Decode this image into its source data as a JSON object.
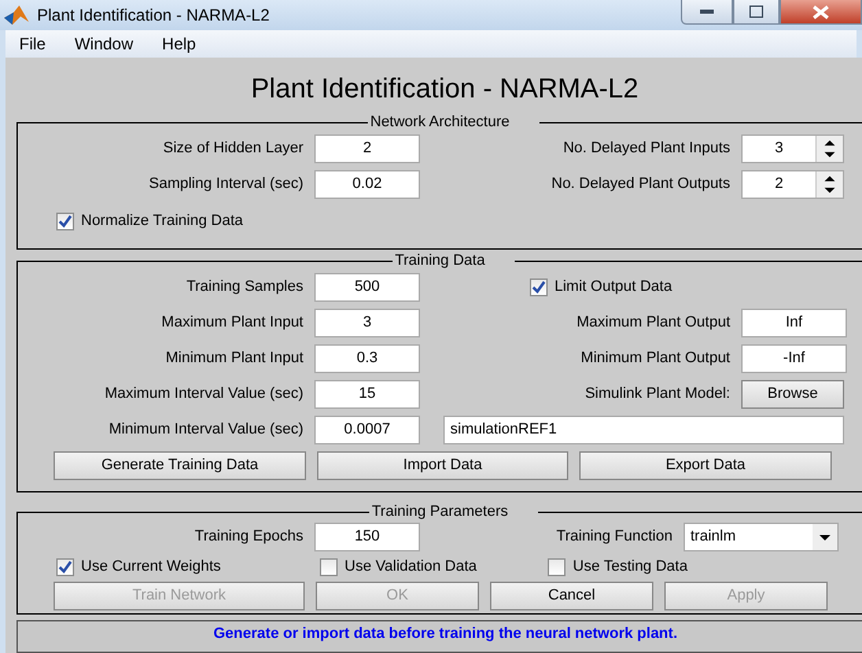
{
  "window": {
    "title": "Plant Identification - NARMA-L2"
  },
  "menu": [
    "File",
    "Window",
    "Help"
  ],
  "heading": "Plant Identification - NARMA-L2",
  "network_architecture": {
    "title": "Network Architecture",
    "rows": [
      {
        "left": {
          "label": "Size of Hidden Layer",
          "value": "2"
        },
        "right": {
          "kind": "spinner",
          "label": "No. Delayed Plant Inputs",
          "value": "3"
        }
      },
      {
        "left": {
          "label": "Sampling Interval (sec)",
          "value": "0.02"
        },
        "right": {
          "kind": "spinner",
          "label": "No. Delayed Plant Outputs",
          "value": "2"
        }
      }
    ],
    "normalize": {
      "label": "Normalize Training Data",
      "checked": true
    }
  },
  "training_data": {
    "title": "Training Data",
    "rows": [
      {
        "left": {
          "label": "Training Samples",
          "value": "500"
        },
        "right": {
          "kind": "checkbox",
          "label": "Limit Output Data",
          "checked": true
        }
      },
      {
        "left": {
          "label": "Maximum Plant Input",
          "value": "3"
        },
        "right": {
          "kind": "field",
          "label": "Maximum Plant Output",
          "value": "Inf"
        }
      },
      {
        "left": {
          "label": "Minimum Plant Input",
          "value": "0.3"
        },
        "right": {
          "kind": "field",
          "label": "Minimum Plant Output",
          "value": "-Inf"
        }
      },
      {
        "left": {
          "label": "Maximum Interval Value (sec)",
          "value": "15"
        },
        "right": {
          "kind": "button",
          "label": "Simulink Plant Model:",
          "button": "Browse"
        }
      },
      {
        "left": {
          "label": "Minimum Interval Value (sec)",
          "value": "0.0007"
        },
        "right": {
          "kind": "wide_field",
          "value": "simulationREF1"
        }
      }
    ],
    "buttons": [
      "Generate Training Data",
      "Import Data",
      "Export Data"
    ]
  },
  "training_parameters": {
    "title": "Training Parameters",
    "epochs": {
      "label": "Training Epochs",
      "value": "150"
    },
    "function": {
      "label": "Training Function",
      "value": "trainlm"
    },
    "checkboxes": [
      {
        "label": "Use Current Weights",
        "checked": true
      },
      {
        "label": "Use Validation Data",
        "checked": false
      },
      {
        "label": "Use Testing Data",
        "checked": false
      }
    ],
    "buttons": [
      {
        "label": "Train Network",
        "disabled": true
      },
      {
        "label": "OK",
        "disabled": true
      },
      {
        "label": "Cancel",
        "disabled": false
      },
      {
        "label": "Apply",
        "disabled": true
      }
    ]
  },
  "status": "Generate or import data before training the neural network plant."
}
